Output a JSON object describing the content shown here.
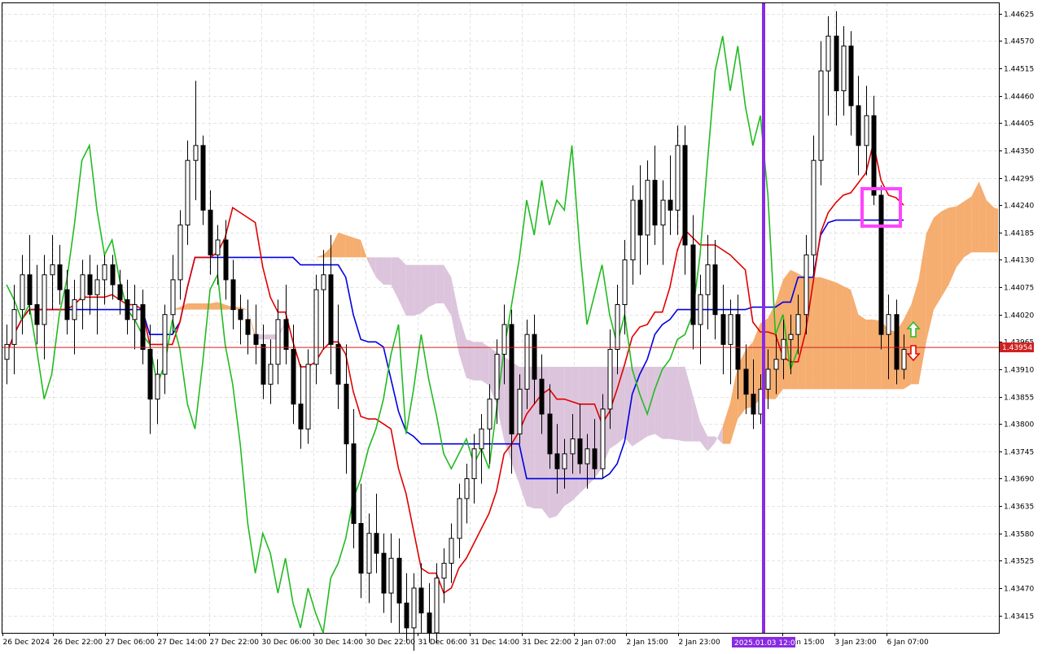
{
  "chart_data": {
    "type": "candlestick",
    "symbol": "",
    "y_axis": {
      "ticks": [
        1.44625,
        1.4457,
        1.44515,
        1.4446,
        1.44405,
        1.4435,
        1.44295,
        1.4424,
        1.44185,
        1.4413,
        1.44075,
        1.4402,
        1.43965,
        1.4391,
        1.43855,
        1.438,
        1.43745,
        1.4369,
        1.43635,
        1.4358,
        1.43525,
        1.4347,
        1.43415
      ],
      "range": [
        1.4338,
        1.44646
      ]
    },
    "current_price": 1.43954,
    "current_price_label": "1.43954",
    "x_axis": {
      "labels": [
        "26 Dec 2024",
        "26 Dec 22:00",
        "27 Dec 06:00",
        "27 Dec 14:00",
        "27 Dec 22:00",
        "30 Dec 06:00",
        "30 Dec 14:00",
        "30 Dec 22:00",
        "31 Dec 06:00",
        "31 Dec 14:00",
        "31 Dec 22:00",
        "2 Jan 07:00",
        "2 Jan 15:00",
        "2 Jan 23:00",
        "3 Jan 15:00",
        "3 Jan 23:00",
        "6 Jan 07:00"
      ],
      "highlight_label": "2025.01.03 12:00"
    },
    "candles_ohlc": [
      [
        1.4393,
        1.44,
        1.4388,
        1.4396
      ],
      [
        1.4396,
        1.4408,
        1.439,
        1.4403
      ],
      [
        1.4403,
        1.4414,
        1.4398,
        1.441
      ],
      [
        1.441,
        1.4418,
        1.4402,
        1.4404
      ],
      [
        1.4404,
        1.4412,
        1.4396,
        1.44
      ],
      [
        1.44,
        1.4414,
        1.4393,
        1.441
      ],
      [
        1.441,
        1.4418,
        1.4403,
        1.4412
      ],
      [
        1.4412,
        1.4416,
        1.4404,
        1.4407
      ],
      [
        1.4407,
        1.4411,
        1.4398,
        1.4401
      ],
      [
        1.4401,
        1.4409,
        1.4394,
        1.4405
      ],
      [
        1.4405,
        1.4413,
        1.4399,
        1.441
      ],
      [
        1.441,
        1.4414,
        1.4402,
        1.4406
      ],
      [
        1.4406,
        1.4412,
        1.4398,
        1.4409
      ],
      [
        1.4409,
        1.4414,
        1.4404,
        1.4412
      ],
      [
        1.4412,
        1.4414,
        1.4405,
        1.4408
      ],
      [
        1.4408,
        1.4411,
        1.4402,
        1.4405
      ],
      [
        1.4405,
        1.4409,
        1.4398,
        1.4401
      ],
      [
        1.4401,
        1.4408,
        1.4395,
        1.4404
      ],
      [
        1.4404,
        1.4407,
        1.4392,
        1.4395
      ],
      [
        1.4395,
        1.44,
        1.4378,
        1.4385
      ],
      [
        1.4385,
        1.4393,
        1.438,
        1.439
      ],
      [
        1.439,
        1.4404,
        1.4386,
        1.4402
      ],
      [
        1.4402,
        1.4414,
        1.4398,
        1.4409
      ],
      [
        1.4409,
        1.4423,
        1.4405,
        1.442
      ],
      [
        1.442,
        1.4437,
        1.4416,
        1.4433
      ],
      [
        1.4433,
        1.4449,
        1.4425,
        1.4436
      ],
      [
        1.4436,
        1.4438,
        1.442,
        1.4423
      ],
      [
        1.4423,
        1.4427,
        1.441,
        1.4414
      ],
      [
        1.4414,
        1.442,
        1.4408,
        1.4417
      ],
      [
        1.4417,
        1.4421,
        1.4405,
        1.4409
      ],
      [
        1.4409,
        1.4413,
        1.4399,
        1.4403
      ],
      [
        1.4403,
        1.4406,
        1.4396,
        1.4401
      ],
      [
        1.4401,
        1.4405,
        1.4394,
        1.4398
      ],
      [
        1.4398,
        1.4404,
        1.4392,
        1.4396
      ],
      [
        1.4396,
        1.44,
        1.4385,
        1.4388
      ],
      [
        1.4388,
        1.4397,
        1.4384,
        1.4392
      ],
      [
        1.4392,
        1.4405,
        1.4388,
        1.4401
      ],
      [
        1.4401,
        1.4408,
        1.4392,
        1.4395
      ],
      [
        1.4395,
        1.44,
        1.438,
        1.4384
      ],
      [
        1.4384,
        1.4392,
        1.4375,
        1.4379
      ],
      [
        1.4379,
        1.4395,
        1.4376,
        1.4392
      ],
      [
        1.4392,
        1.441,
        1.4388,
        1.4407
      ],
      [
        1.4407,
        1.4415,
        1.4395,
        1.441
      ],
      [
        1.441,
        1.4418,
        1.439,
        1.4396
      ],
      [
        1.4396,
        1.4404,
        1.4383,
        1.4388
      ],
      [
        1.4388,
        1.4396,
        1.437,
        1.4376
      ],
      [
        1.4376,
        1.4383,
        1.4355,
        1.436
      ],
      [
        1.436,
        1.4368,
        1.4345,
        1.435
      ],
      [
        1.435,
        1.4362,
        1.4344,
        1.4358
      ],
      [
        1.4358,
        1.4366,
        1.435,
        1.4354
      ],
      [
        1.4354,
        1.4358,
        1.4342,
        1.4346
      ],
      [
        1.4346,
        1.4358,
        1.434,
        1.4353
      ],
      [
        1.4353,
        1.4357,
        1.4338,
        1.4344
      ],
      [
        1.4344,
        1.435,
        1.4336,
        1.4339
      ],
      [
        1.4339,
        1.435,
        1.4334,
        1.4347
      ],
      [
        1.4347,
        1.4352,
        1.4338,
        1.4342
      ],
      [
        1.4342,
        1.4348,
        1.4336,
        1.4338
      ],
      [
        1.4338,
        1.4352,
        1.4336,
        1.4349
      ],
      [
        1.4349,
        1.4355,
        1.4344,
        1.4352
      ],
      [
        1.4352,
        1.436,
        1.4348,
        1.4357
      ],
      [
        1.4357,
        1.4368,
        1.4353,
        1.4365
      ],
      [
        1.4365,
        1.4372,
        1.436,
        1.4369
      ],
      [
        1.4369,
        1.4378,
        1.4364,
        1.4375
      ],
      [
        1.4375,
        1.4382,
        1.4368,
        1.4379
      ],
      [
        1.4379,
        1.4388,
        1.4372,
        1.4385
      ],
      [
        1.4385,
        1.4397,
        1.438,
        1.4394
      ],
      [
        1.4394,
        1.4404,
        1.4388,
        1.44
      ],
      [
        1.44,
        1.4403,
        1.437,
        1.4378
      ],
      [
        1.4378,
        1.439,
        1.4376,
        1.4387
      ],
      [
        1.4387,
        1.4401,
        1.4383,
        1.4398
      ],
      [
        1.4398,
        1.4402,
        1.4384,
        1.4389
      ],
      [
        1.4389,
        1.4394,
        1.4378,
        1.4382
      ],
      [
        1.4382,
        1.4388,
        1.4371,
        1.4374
      ],
      [
        1.4374,
        1.438,
        1.4366,
        1.4371
      ],
      [
        1.4371,
        1.4377,
        1.4367,
        1.4374
      ],
      [
        1.4374,
        1.4382,
        1.437,
        1.4377
      ],
      [
        1.4377,
        1.4384,
        1.437,
        1.4372
      ],
      [
        1.4372,
        1.4378,
        1.4367,
        1.4375
      ],
      [
        1.4375,
        1.4381,
        1.4369,
        1.4371
      ],
      [
        1.4371,
        1.4386,
        1.4369,
        1.4383
      ],
      [
        1.4383,
        1.4399,
        1.4379,
        1.4395
      ],
      [
        1.4395,
        1.4408,
        1.439,
        1.4404
      ],
      [
        1.4404,
        1.4417,
        1.4398,
        1.4413
      ],
      [
        1.4413,
        1.4428,
        1.4408,
        1.4425
      ],
      [
        1.4425,
        1.4432,
        1.441,
        1.4418
      ],
      [
        1.4418,
        1.4433,
        1.4412,
        1.4429
      ],
      [
        1.4429,
        1.4436,
        1.4416,
        1.442
      ],
      [
        1.442,
        1.4429,
        1.4412,
        1.4425
      ],
      [
        1.4425,
        1.4434,
        1.4418,
        1.4423
      ],
      [
        1.4423,
        1.444,
        1.4418,
        1.4436
      ],
      [
        1.4436,
        1.444,
        1.441,
        1.4416
      ],
      [
        1.4416,
        1.4422,
        1.4395,
        1.44
      ],
      [
        1.44,
        1.441,
        1.4392,
        1.4406
      ],
      [
        1.4406,
        1.4418,
        1.4399,
        1.4412
      ],
      [
        1.4412,
        1.4417,
        1.4397,
        1.4402
      ],
      [
        1.4402,
        1.4408,
        1.439,
        1.4396
      ],
      [
        1.4396,
        1.4405,
        1.4388,
        1.4402
      ],
      [
        1.4402,
        1.4406,
        1.4385,
        1.4391
      ],
      [
        1.4391,
        1.4396,
        1.4382,
        1.4386
      ],
      [
        1.4386,
        1.4393,
        1.4379,
        1.4382
      ],
      [
        1.4382,
        1.439,
        1.438,
        1.4387
      ],
      [
        1.4387,
        1.4395,
        1.4383,
        1.4391
      ],
      [
        1.4391,
        1.4398,
        1.4386,
        1.4393
      ],
      [
        1.4393,
        1.4401,
        1.4389,
        1.4397
      ],
      [
        1.4397,
        1.4402,
        1.439,
        1.4398
      ],
      [
        1.4398,
        1.4406,
        1.4394,
        1.4402
      ],
      [
        1.4402,
        1.4418,
        1.4398,
        1.4414
      ],
      [
        1.4414,
        1.4438,
        1.441,
        1.4433
      ],
      [
        1.4433,
        1.4457,
        1.4428,
        1.4451
      ],
      [
        1.4451,
        1.4462,
        1.4442,
        1.4458
      ],
      [
        1.4458,
        1.4463,
        1.444,
        1.4447
      ],
      [
        1.4447,
        1.446,
        1.4442,
        1.4456
      ],
      [
        1.4456,
        1.4459,
        1.4438,
        1.4444
      ],
      [
        1.4444,
        1.445,
        1.443,
        1.4436
      ],
      [
        1.4436,
        1.4448,
        1.443,
        1.4442
      ],
      [
        1.4442,
        1.4446,
        1.4424,
        1.4426
      ],
      [
        1.4426,
        1.4428,
        1.4395,
        1.4398
      ],
      [
        1.4398,
        1.4406,
        1.4389,
        1.4402
      ],
      [
        1.4402,
        1.4405,
        1.4388,
        1.4391
      ],
      [
        1.4391,
        1.4398,
        1.4389,
        1.4395
      ]
    ],
    "series": [
      {
        "color": "#e00000",
        "role": "tenkan"
      },
      {
        "color": "#0000e0",
        "role": "kijun"
      },
      {
        "color": "#22bb22",
        "role": "chikou"
      }
    ],
    "cloud_colors": {
      "bullish": "#f4a460",
      "bearish": "#d8bfd8"
    },
    "colors": {
      "grid": "#e4e4e4",
      "price_line": "#d02020",
      "vertical_marker": "#8a2be2",
      "highlight_box": "#ff44ff",
      "arrow_up": "#22bb22",
      "arrow_down": "#e00000"
    },
    "grid": true
  }
}
